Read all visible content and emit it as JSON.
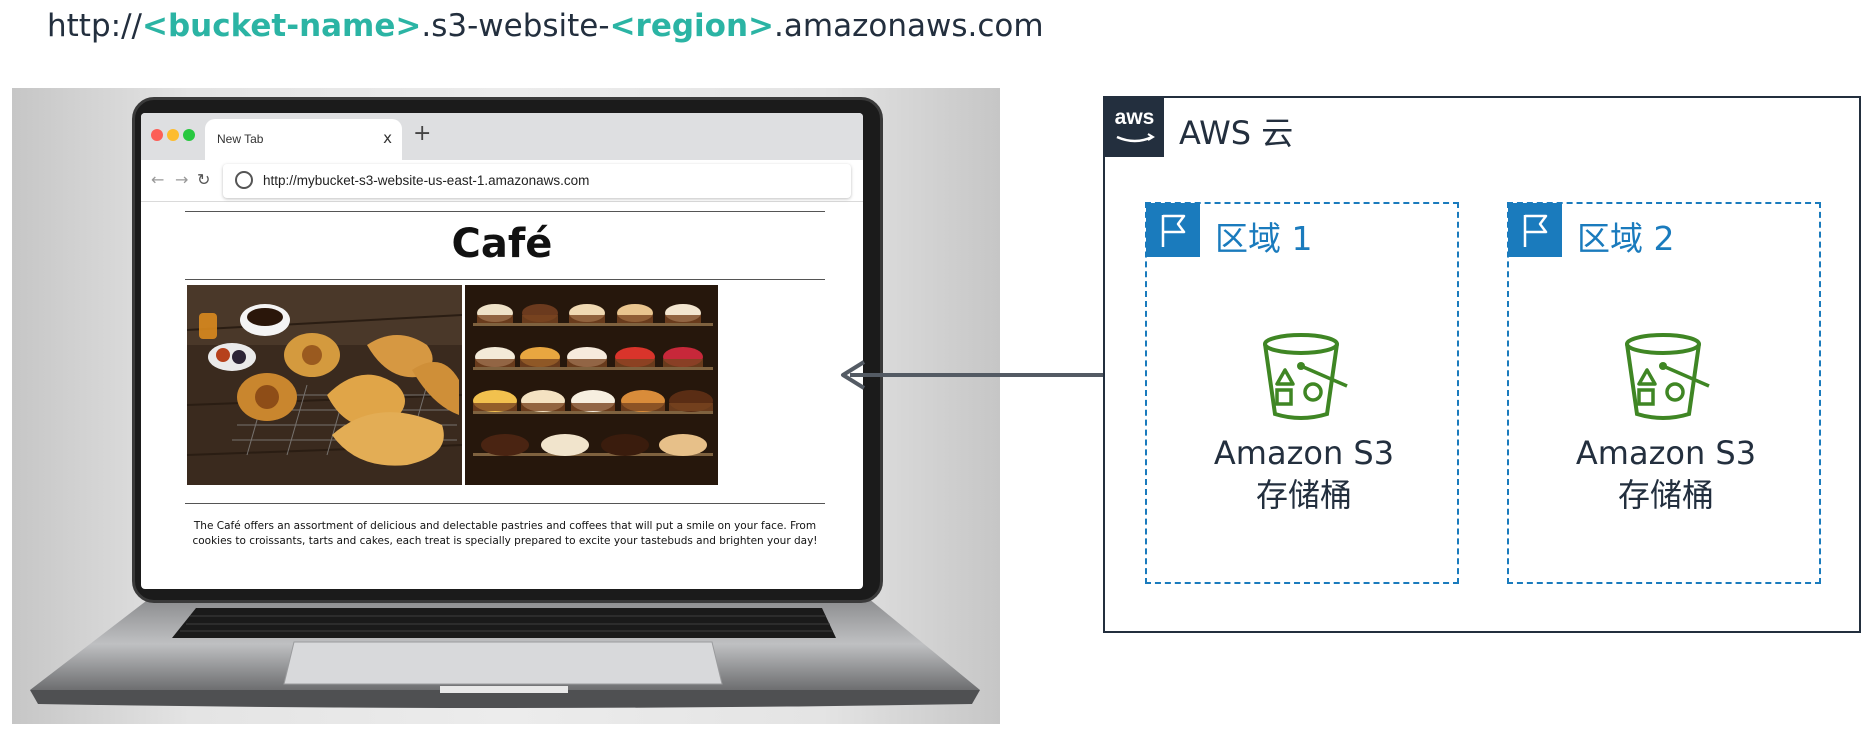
{
  "url_template": {
    "prefix": "http://",
    "bucket_placeholder": "<bucket-name>",
    "middle": ".s3-website-",
    "region_placeholder": "<region>",
    "suffix": ".amazonaws.com"
  },
  "browser": {
    "tab_title": "New Tab",
    "tab_close": "x",
    "new_tab": "+",
    "address": "http://mybucket-s3-website-us-east-1.amazonaws.com"
  },
  "website": {
    "title": "Café",
    "caption": "The Café offers an assortment of delicious and delectable pastries and coffees that will put a smile on your face. From cookies to croissants, tarts and cakes, each treat is specially prepared to excite your tastebuds and brighten your day!"
  },
  "aws_cloud": {
    "logo_text": "aws",
    "title": "AWS 云",
    "regions": [
      {
        "label": "区域 1",
        "bucket_line1": "Amazon S3",
        "bucket_line2": "存储桶"
      },
      {
        "label": "区域 2",
        "bucket_line1": "Amazon S3",
        "bucket_line2": "存储桶"
      }
    ]
  },
  "colors": {
    "placeholder_teal": "#2bb4a4",
    "region_blue": "#1a7bbd",
    "s3_green": "#3f8624",
    "aws_dark": "#232f3e",
    "arrow_gray": "#545b64"
  }
}
